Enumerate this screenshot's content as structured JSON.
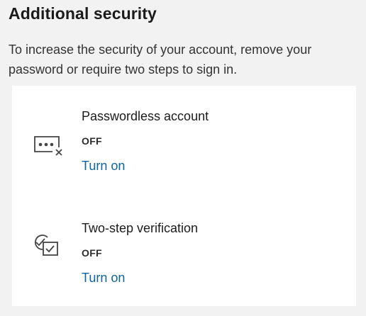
{
  "section": {
    "title": "Additional security",
    "description": "To increase the security of your account, remove your password or require two steps to sign in."
  },
  "options": [
    {
      "icon": "password-off-icon",
      "title": "Passwordless account",
      "status": "OFF",
      "action": "Turn on"
    },
    {
      "icon": "two-step-verification-icon",
      "title": "Two-step verification",
      "status": "OFF",
      "action": "Turn on"
    }
  ],
  "colors": {
    "page_background": "#f2f2f2",
    "card_background": "#ffffff",
    "link": "#0f6597",
    "text": "#1b1b1b"
  }
}
